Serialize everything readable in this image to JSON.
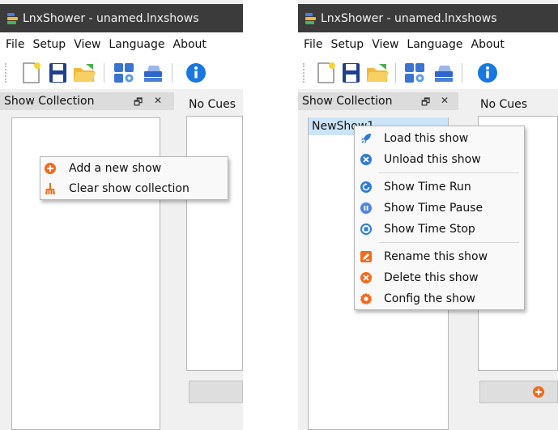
{
  "window_title": "LnxShower - unamed.lnxshows",
  "menu": [
    "File",
    "Setup",
    "View",
    "Language",
    "About"
  ],
  "dock": {
    "title": "Show Collection",
    "float_symbol": "🗗",
    "close_symbol": "✕"
  },
  "cues_label": "No Cues",
  "show_item": "NewShow1",
  "colors": {
    "titlebar": "#3b3b3b",
    "accent_orange": "#f26b1d",
    "accent_blue": "#2e7bd6",
    "selection": "#cce4f7"
  },
  "left_context_menu": [
    {
      "label": "Add a new show",
      "icon": "add-circle-icon"
    },
    {
      "label": "Clear show collection",
      "icon": "broom-icon"
    }
  ],
  "right_context_menu": [
    {
      "label": "Load this show",
      "icon": "rocket-icon"
    },
    {
      "label": "Unload this show",
      "icon": "close-circle-icon"
    },
    {
      "label": "Show Time Run",
      "icon": "refresh-icon"
    },
    {
      "label": "Show Time Pause",
      "icon": "pause-icon"
    },
    {
      "label": "Show Time Stop",
      "icon": "stop-icon"
    },
    {
      "label": "Rename this show",
      "icon": "rename-icon"
    },
    {
      "label": "Delete this show",
      "icon": "delete-circle-icon"
    },
    {
      "label": "Config the show",
      "icon": "gear-icon"
    }
  ]
}
